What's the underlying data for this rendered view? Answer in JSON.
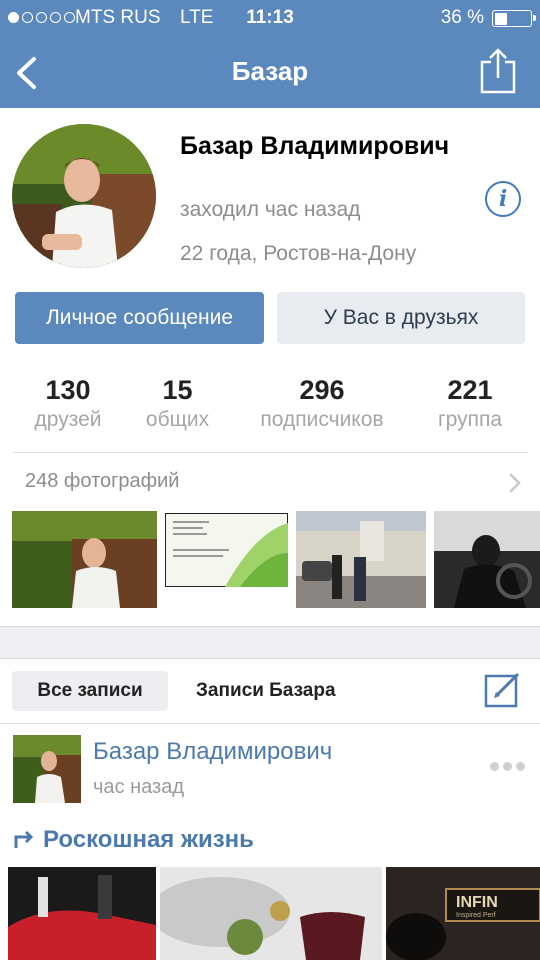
{
  "status_bar": {
    "carrier": "MTS RUS",
    "network": "LTE",
    "time": "11:13",
    "battery_percent": "36 %"
  },
  "nav": {
    "title": "Базар"
  },
  "profile": {
    "name": "Базар Владимирович",
    "last_seen": "заходил час назад",
    "location": "22 года, Ростов-на-Дону"
  },
  "actions": {
    "message_label": "Личное сообщение",
    "friends_label": "У Вас в друзьях"
  },
  "stats": [
    {
      "count": "130",
      "label": "друзей"
    },
    {
      "count": "15",
      "label": "общих"
    },
    {
      "count": "296",
      "label": "подписчиков"
    },
    {
      "count": "221",
      "label": "группа"
    }
  ],
  "photos": {
    "label": "248 фотографий"
  },
  "wall_tabs": {
    "all": "Все записи",
    "own": "Записи Базара"
  },
  "post": {
    "author": "Базар Владимирович",
    "time": "час назад",
    "repost_title": "Роскошная жизнь"
  },
  "colors": {
    "header": "#5b88bd",
    "link": "#4d7aae",
    "button_primary": "#5b88bd",
    "button_secondary": "#e8ebef"
  }
}
